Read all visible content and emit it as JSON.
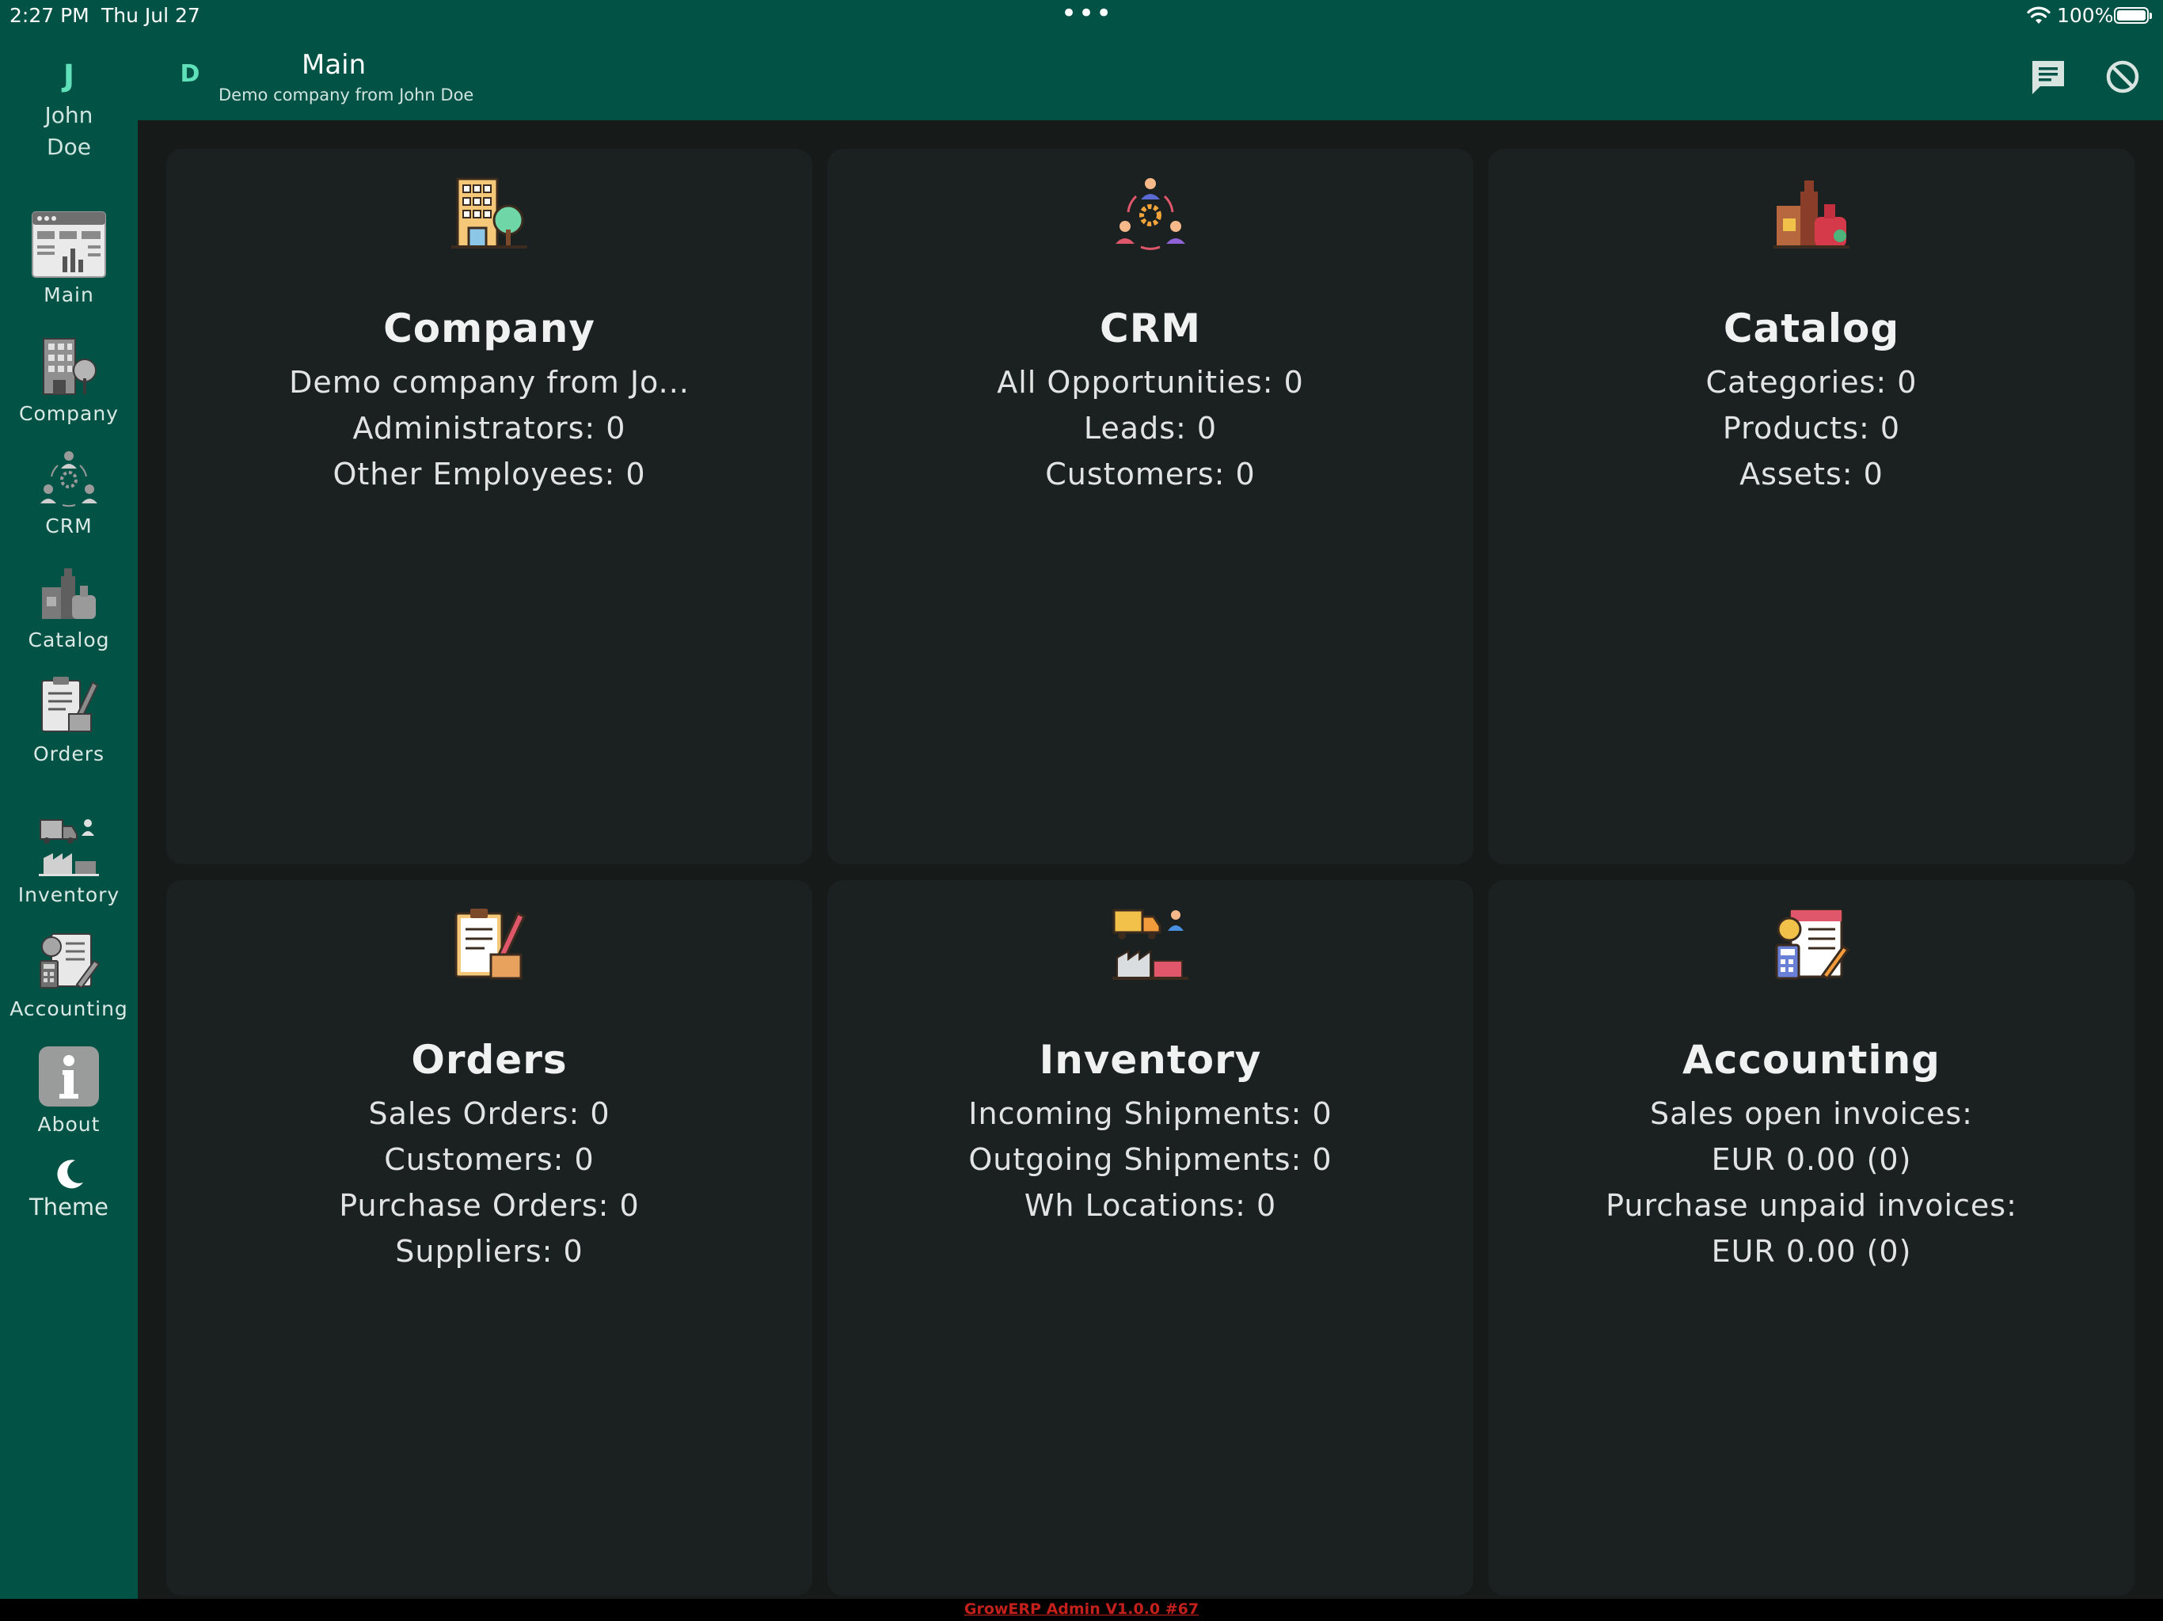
{
  "status_bar": {
    "time": "2:27 PM",
    "date": "Thu Jul 27",
    "more_dots": "•••",
    "battery_percent": "100%",
    "battery_level": 1.0
  },
  "rail": {
    "user_initial": "J",
    "user_name_first": "John",
    "user_name_last": "Doe",
    "items": [
      {
        "label": "Main",
        "icon": "dashboard-icon"
      },
      {
        "label": "Company",
        "icon": "building-icon"
      },
      {
        "label": "CRM",
        "icon": "people-network-icon"
      },
      {
        "label": "Catalog",
        "icon": "products-icon"
      },
      {
        "label": "Orders",
        "icon": "order-clipboard-icon"
      },
      {
        "label": "Inventory",
        "icon": "truck-warehouse-icon"
      },
      {
        "label": "Accounting",
        "icon": "invoice-calculator-icon"
      },
      {
        "label": "About",
        "icon": "info-icon"
      },
      {
        "label": "Theme",
        "icon": "moon-icon"
      }
    ]
  },
  "appbar": {
    "company_initial": "D",
    "title": "Main",
    "subtitle": "Demo company from John Doe"
  },
  "cards": [
    {
      "title": "Company",
      "icon": "building-icon",
      "lines": [
        "Demo company from Jo...",
        "Administrators: 0",
        "Other Employees: 0"
      ]
    },
    {
      "title": "CRM",
      "icon": "people-network-icon",
      "lines": [
        "All Opportunities: 0",
        "Leads: 0",
        "Customers: 0"
      ]
    },
    {
      "title": "Catalog",
      "icon": "products-icon",
      "lines": [
        "Categories: 0",
        "Products: 0",
        "Assets: 0"
      ]
    },
    {
      "title": "Orders",
      "icon": "order-clipboard-icon",
      "lines": [
        "Sales Orders: 0",
        "Customers: 0",
        "Purchase Orders: 0",
        "Suppliers: 0"
      ]
    },
    {
      "title": "Inventory",
      "icon": "truck-warehouse-icon",
      "lines": [
        "Incoming Shipments: 0",
        "Outgoing Shipments: 0",
        "Wh Locations: 0"
      ]
    },
    {
      "title": "Accounting",
      "icon": "invoice-calculator-icon",
      "lines": [
        "Sales open invoices:",
        "EUR 0.00 (0)",
        "Purchase unpaid invoices:",
        "EUR 0.00 (0)"
      ]
    }
  ],
  "footer": {
    "version": "GrowERP Admin V1.0.0 #67"
  },
  "colors": {
    "primary": "#025246",
    "accent": "#5fe0b9",
    "card": "#1b2120",
    "background": "#161b1a",
    "version_text": "#c3201c"
  }
}
